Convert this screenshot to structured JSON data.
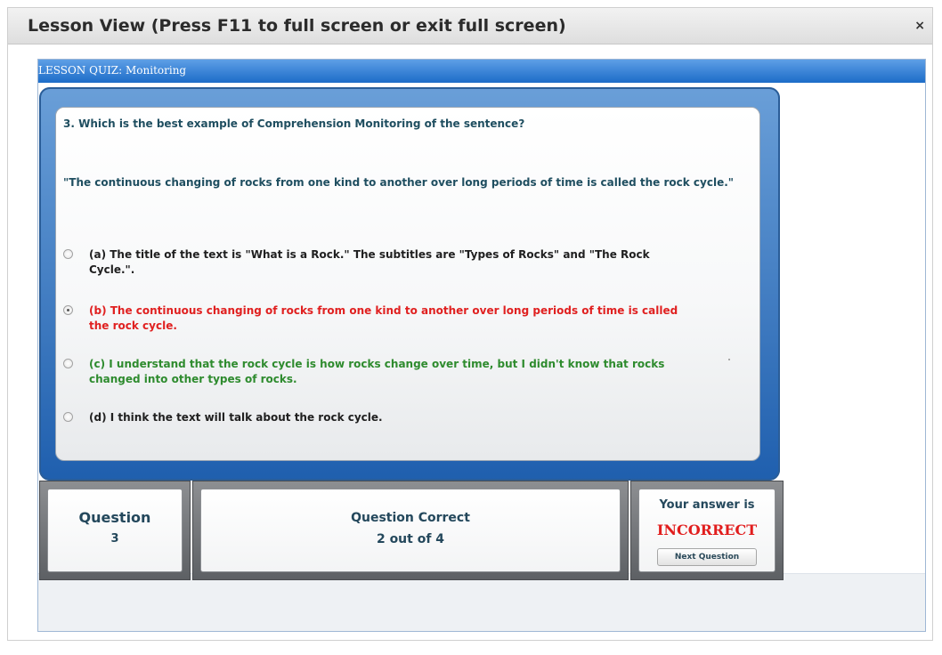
{
  "modal": {
    "title": "Lesson View (Press F11 to full screen or exit full screen)",
    "close": "×"
  },
  "lesson": {
    "header": "LESSON QUIZ: Monitoring"
  },
  "question": {
    "text": "3. Which is the best example of Comprehension Monitoring of the sentence?",
    "sentence": "\"The continuous changing of rocks from one kind to another over long periods of time is called the rock cycle.\"",
    "options": [
      {
        "label": "(a) The title of the text is \"What is a Rock.\"  The subtitles are \"Types of Rocks\" and \"The Rock Cycle.\".",
        "selected": false,
        "color": "#202020"
      },
      {
        "label": "(b) The continuous changing of rocks from one kind to another over long periods of time is called the rock cycle.",
        "selected": true,
        "color": "#e02020"
      },
      {
        "label": "(c) I understand that the rock cycle is how rocks change over time, but I didn't know that rocks changed into other types of rocks.",
        "selected": false,
        "color": "#2e8b2e"
      },
      {
        "label": "(d) I think the text will talk about the rock cycle.",
        "selected": false,
        "color": "#202020"
      }
    ]
  },
  "status": {
    "question_label": "Question",
    "question_number": "3",
    "correct_label": "Question Correct",
    "correct_value": "2 out of 4",
    "answer_label": "Your answer is",
    "answer_value": "INCORRECT",
    "next_button": "Next Question"
  },
  "colors": {
    "header_blue": "#1c6cc8",
    "incorrect_red": "#e11d1d",
    "correct_green": "#2e8b2e"
  }
}
